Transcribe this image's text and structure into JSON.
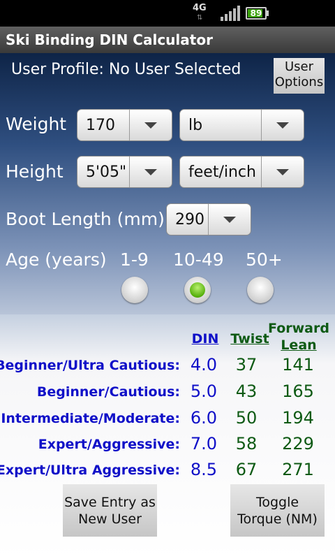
{
  "status_bar": {
    "network": "4G",
    "battery_level": "89",
    "battery_percent": 89
  },
  "app": {
    "title": "Ski Binding DIN Calculator"
  },
  "profile": {
    "label": "User Profile: No User Selected",
    "options_line1": "User",
    "options_line2": "Options"
  },
  "weight": {
    "label": "Weight",
    "value": "170",
    "unit": "lb"
  },
  "height": {
    "label": "Height",
    "value": "5'05\"",
    "unit": "feet/inch"
  },
  "boot": {
    "label": "Boot Length (mm)",
    "value": "290"
  },
  "age": {
    "label": "Age (years)",
    "options": [
      {
        "label": "1-9",
        "selected": false
      },
      {
        "label": "10-49",
        "selected": true
      },
      {
        "label": "50+",
        "selected": false
      }
    ]
  },
  "results": {
    "headers": {
      "din": "DIN",
      "twist": "Twist",
      "forward_line1": "Forward",
      "forward_line2": "Lean"
    },
    "rows": [
      {
        "label": "Beginner/Ultra Cautious:",
        "din": "4.0",
        "twist": "37",
        "forward": "141"
      },
      {
        "label": "Beginner/Cautious:",
        "din": "5.0",
        "twist": "43",
        "forward": "165"
      },
      {
        "label": "Intermediate/Moderate:",
        "din": "6.0",
        "twist": "50",
        "forward": "194"
      },
      {
        "label": "Expert/Aggressive:",
        "din": "7.0",
        "twist": "58",
        "forward": "229"
      },
      {
        "label": "Expert/Ultra Aggressive:",
        "din": "8.5",
        "twist": "67",
        "forward": "271"
      }
    ]
  },
  "actions": {
    "save_line1": "Save Entry as",
    "save_line2": "New User",
    "toggle_line1": "Toggle",
    "toggle_line2": "Torque (NM)"
  },
  "colors": {
    "din_color": "#1010c8",
    "green_color": "#0e5a14",
    "radio_checked": "#56b00c"
  }
}
